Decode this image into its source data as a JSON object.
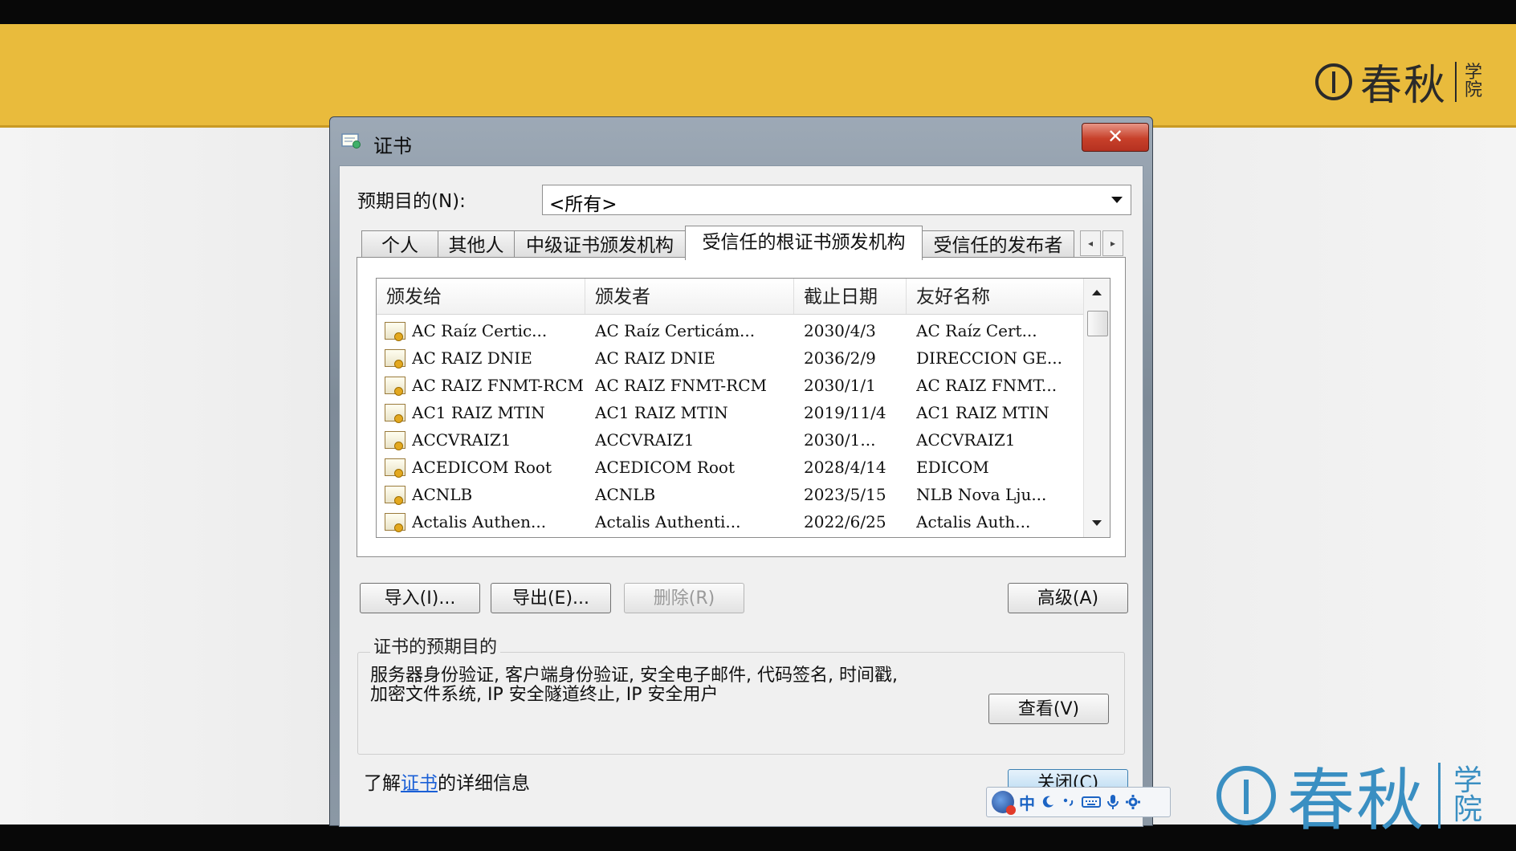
{
  "brand": {
    "name": "春秋",
    "sub": [
      "学",
      "院"
    ]
  },
  "dialog": {
    "title": "证书",
    "close_symbol": "✕",
    "purpose_label": "预期目的(N):",
    "purpose_value": "<所有>",
    "tabs": [
      "个人",
      "其他人",
      "中级证书颁发机构",
      "受信任的根证书颁发机构",
      "受信任的发布者"
    ],
    "active_tab": "受信任的根证书颁发机构",
    "tab_scroll_left": "◂",
    "tab_scroll_right": "▸",
    "columns": [
      "颁发给",
      "颁发者",
      "截止日期",
      "友好名称"
    ],
    "rows": [
      [
        "AC Raíz Certic...",
        "AC Raíz Certicám...",
        "2030/4/3",
        "AC Raíz Cert..."
      ],
      [
        "AC RAIZ DNIE",
        "AC RAIZ DNIE",
        "2036/2/9",
        "DIRECCION GE..."
      ],
      [
        "AC RAIZ FNMT-RCM",
        "AC RAIZ FNMT-RCM",
        "2030/1/1",
        "AC RAIZ FNMT..."
      ],
      [
        "AC1 RAIZ MTIN",
        "AC1 RAIZ MTIN",
        "2019/11/4",
        "AC1 RAIZ MTIN"
      ],
      [
        "ACCVRAIZ1",
        "ACCVRAIZ1",
        "2030/1...",
        "ACCVRAIZ1"
      ],
      [
        "ACEDICOM Root",
        "ACEDICOM Root",
        "2028/4/14",
        "EDICOM"
      ],
      [
        "ACNLB",
        "ACNLB",
        "2023/5/15",
        "NLB Nova Lju..."
      ],
      [
        "Actalis Authen...",
        "Actalis Authenti...",
        "2022/6/25",
        "Actalis Auth..."
      ]
    ],
    "buttons": {
      "import": "导入(I)...",
      "export": "导出(E)...",
      "remove": "删除(R)",
      "advanced": "高级(A)",
      "view": "查看(V)",
      "close": "关闭(C)"
    },
    "group_title": "证书的预期目的",
    "group_desc_line1": "服务器身份验证, 客户端身份验证, 安全电子邮件, 代码签名, 时间戳,",
    "group_desc_line2": "加密文件系统, IP 安全隧道终止, IP 安全用户",
    "footer_prefix": "了解",
    "footer_link": "证书",
    "footer_suffix": "的详细信息"
  },
  "ime": {
    "lang": "中",
    "icons": [
      "moon-icon",
      "punctuation-icon",
      "keyboard-icon",
      "mic-icon",
      "settings-icon"
    ]
  }
}
